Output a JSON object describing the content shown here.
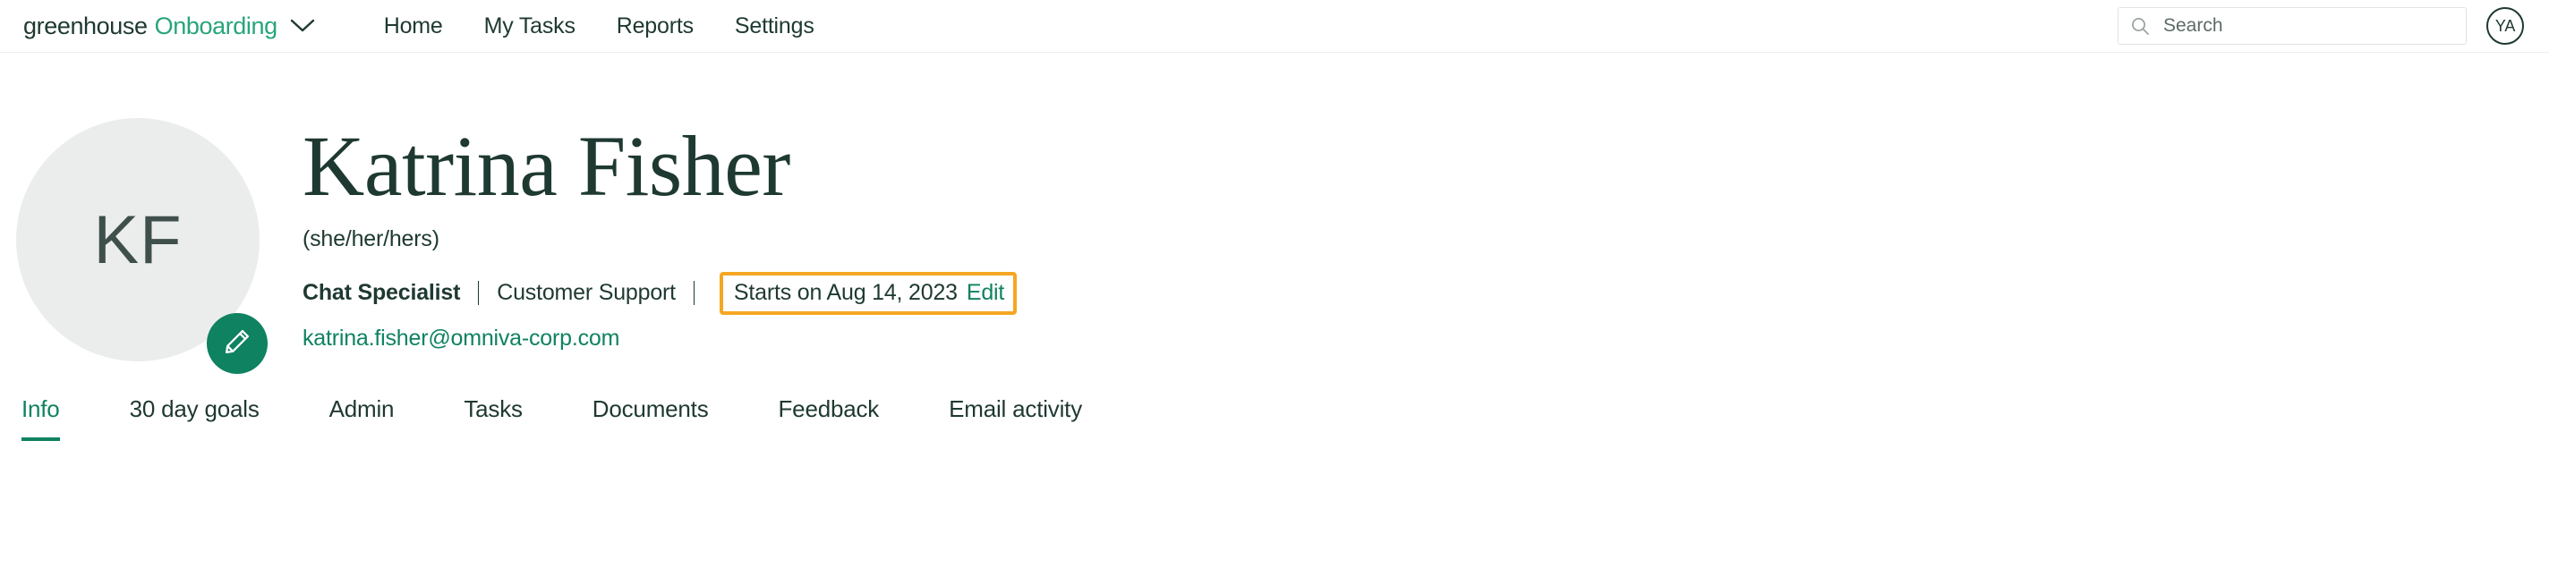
{
  "header": {
    "brand": {
      "primary": "greenhouse",
      "secondary": "Onboarding",
      "caret_icon": "chevron-down-icon"
    },
    "nav": [
      {
        "label": "Home"
      },
      {
        "label": "My Tasks"
      },
      {
        "label": "Reports"
      },
      {
        "label": "Settings"
      }
    ],
    "search": {
      "placeholder": "Search",
      "value": "",
      "icon": "search-icon"
    },
    "account_avatar": {
      "initials": "YA"
    }
  },
  "profile": {
    "avatar": {
      "initials": "KF",
      "edit_badge_icon": "pencil-icon"
    },
    "name": "Katrina Fisher",
    "pronouns": "(she/her/hers)",
    "job_title": "Chat Specialist",
    "department": "Customer Support",
    "start_date": "Starts on Aug 14, 2023",
    "start_date_edit_label": "Edit",
    "email": "katrina.fisher@omniva-corp.com"
  },
  "tabs": [
    {
      "label": "Info",
      "active": true
    },
    {
      "label": "30 day goals",
      "active": false
    },
    {
      "label": "Admin",
      "active": false
    },
    {
      "label": "Tasks",
      "active": false
    },
    {
      "label": "Documents",
      "active": false
    },
    {
      "label": "Feedback",
      "active": false
    },
    {
      "label": "Email activity",
      "active": false
    }
  ],
  "colors": {
    "brand_green": "#27a579",
    "accent_green": "#0f8261",
    "dark_green": "#1e3932",
    "highlight_orange": "#f5a623",
    "avatar_gray": "#ebedec"
  }
}
